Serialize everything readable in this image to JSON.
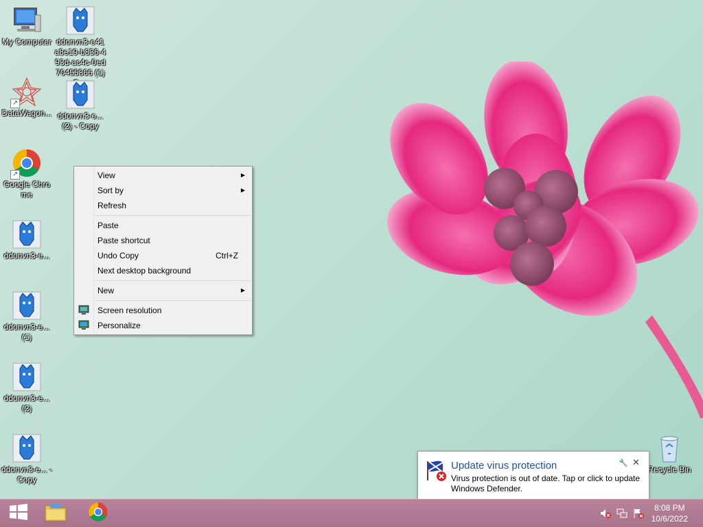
{
  "desktop": {
    "icons": [
      {
        "label": "My Computer",
        "icon": "computer-icon"
      },
      {
        "label": "ddonvn3-e41 a8e19-b836-4 93d-ac4c-0ed 70455866 (1) - Copy",
        "icon": "blue-creature-icon"
      },
      {
        "label": "DataWagon...",
        "icon": "datawagon-icon"
      },
      {
        "label": "ddonvn3-e... (2) - Copy",
        "icon": "blue-creature-icon"
      },
      {
        "label": "Google Chrome",
        "icon": "chrome-icon"
      },
      {
        "label": "ddonvn3-e...",
        "icon": "blue-creature-icon"
      },
      {
        "label": "ddonvn3-e... (1)",
        "icon": "blue-creature-icon"
      },
      {
        "label": "ddonvn3-e... (2)",
        "icon": "blue-creature-icon"
      },
      {
        "label": "ddonvn3-e... - Copy",
        "icon": "blue-creature-icon"
      },
      {
        "label": "Recycle Bin",
        "icon": "recycle-bin-icon"
      }
    ]
  },
  "context_menu": {
    "items": [
      {
        "label": "View",
        "submenu": true
      },
      {
        "label": "Sort by",
        "submenu": true
      },
      {
        "label": "Refresh"
      },
      {
        "label": "Paste"
      },
      {
        "label": "Paste shortcut"
      },
      {
        "label": "Undo Copy",
        "shortcut": "Ctrl+Z"
      },
      {
        "label": "Next desktop background"
      },
      {
        "label": "New",
        "submenu": true
      },
      {
        "label": "Screen resolution",
        "icon": "monitor-icon"
      },
      {
        "label": "Personalize",
        "icon": "personalize-icon"
      }
    ]
  },
  "notification": {
    "title": "Update virus protection",
    "body": "Virus protection is out of date. Tap or click to update Windows Defender.",
    "icon": "defender-flag-icon"
  },
  "taskbar": {
    "pinned": [
      "start-icon",
      "file-explorer-icon",
      "chrome-icon"
    ],
    "clock_time": "8:08 PM",
    "clock_date": "10/6/2022"
  }
}
